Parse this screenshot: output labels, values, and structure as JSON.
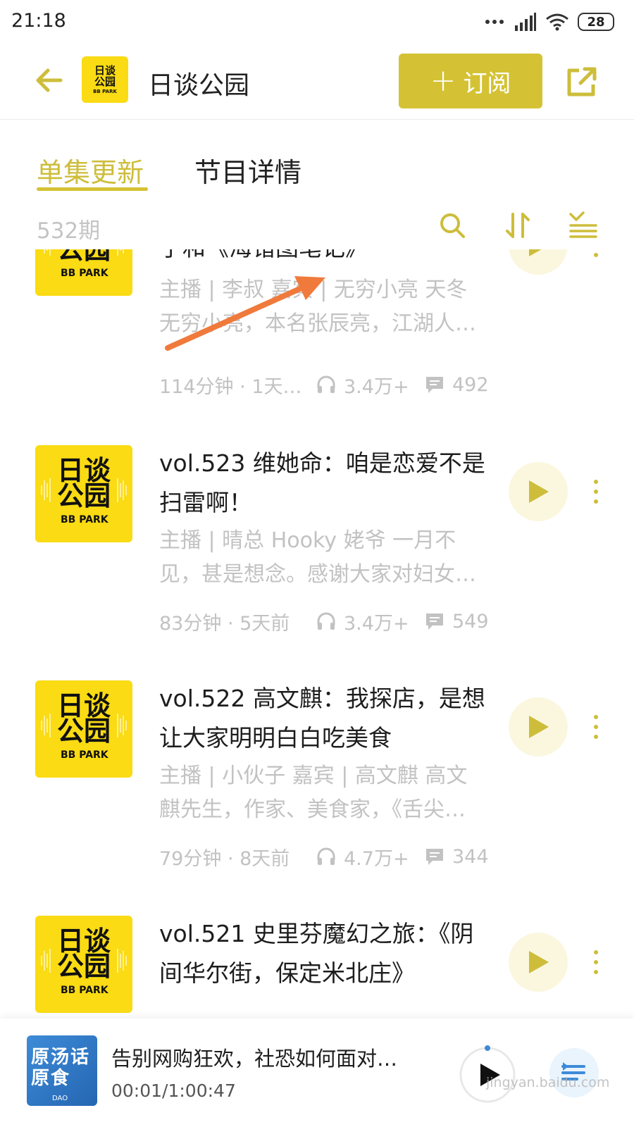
{
  "status_bar": {
    "time": "21:18",
    "battery": "28"
  },
  "header": {
    "logo_line1": "日谈",
    "logo_line2": "公园",
    "logo_sub": "BB PARK",
    "title": "日谈公园",
    "subscribe_plus": "+",
    "subscribe_label": "订阅"
  },
  "tabs": [
    {
      "label": "单集更新",
      "active": true
    },
    {
      "label": "节目详情",
      "active": false
    }
  ],
  "episode_count": "532期",
  "toolbar_icons": [
    "search-icon",
    "sort-icon",
    "filter-list-icon"
  ],
  "episodes": [
    {
      "title": "子和《海错图笔记》",
      "desc_line1": "主播 | 李叔 嘉宾 | 无穷小亮 天冬",
      "desc_line2": "无穷小亮，本名张辰亮，江湖人…",
      "duration_ago": "114分钟 · 1天…",
      "plays": "3.4万+",
      "comments": "492"
    },
    {
      "title": "vol.523 维她命：咱是恋爱不是扫雷啊！",
      "desc_line1": "主播 | 晴总 Hooky 姥爷 一月不",
      "desc_line2": "见，甚是想念。感谢大家对妇女…",
      "duration_ago": "83分钟 · 5天前",
      "plays": "3.4万+",
      "comments": "549"
    },
    {
      "title": "vol.522 高文麒：我探店，是想让大家明明白白吃美食",
      "desc_line1": "主播 | 小伙子 嘉宾 | 高文麒 高文",
      "desc_line2": "麒先生，作家、美食家，《舌尖…",
      "duration_ago": "79分钟 · 8天前",
      "plays": "4.7万+",
      "comments": "344"
    },
    {
      "title": "vol.521 史里芬魔幻之旅：《阴间华尔街，保定米北庄》",
      "desc_line1": "",
      "desc_line2": "",
      "duration_ago": "",
      "plays": "",
      "comments": ""
    }
  ],
  "cover": {
    "line1": "日谈",
    "line2": "公园",
    "sub": "BB PARK"
  },
  "mini_player": {
    "cover_text": "原汤话原食",
    "cover_sub": "DAO",
    "title": "告别网购狂欢，社恐如何面对…",
    "time": "00:01/1:00:47"
  },
  "watermark": "jingyan.baidu.com",
  "colors": {
    "accent": "#d4c234",
    "cover_yellow": "#fadb14",
    "arrow": "#f07a3c"
  }
}
